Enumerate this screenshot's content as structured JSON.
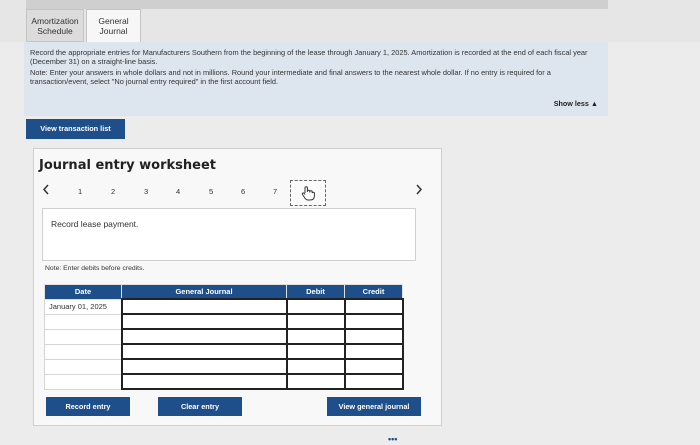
{
  "tabs": [
    {
      "label_line1": "Amortization",
      "label_line2": "Schedule"
    },
    {
      "label_line1": "General",
      "label_line2": "Journal"
    }
  ],
  "instructions": {
    "main": "Record the appropriate entries for Manufacturers Southern from the beginning of the lease through January 1, 2025. Amortization is recorded at the end of each fiscal year (December 31) on a straight-line basis.",
    "note": "Note: Enter your answers in whole dollars and not in millions. Round your intermediate and final answers to the nearest whole dollar. If no entry is required for a transaction/event, select \"No journal entry required\" in the first account field.",
    "show_less": "Show less ▲"
  },
  "view_transaction_list": "View transaction list",
  "worksheet": {
    "title": "Journal entry worksheet",
    "prev_icon": "chevron-left-icon",
    "next_icon": "chevron-right-icon",
    "pages": [
      "1",
      "2",
      "3",
      "4",
      "5",
      "6",
      "7"
    ],
    "current_page_icon": "hand-pointer-icon",
    "record_text": "Record lease payment.",
    "note": "Note: Enter debits before credits.",
    "table": {
      "headers": {
        "date": "Date",
        "general_journal": "General Journal",
        "debit": "Debit",
        "credit": "Credit"
      },
      "first_date": "January 01, 2025"
    },
    "buttons": {
      "record": "Record entry",
      "clear": "Clear entry",
      "view_general": "View general journal"
    }
  },
  "colors": {
    "accent": "#1f4f8a",
    "instruction_bg": "#dde6ef"
  }
}
